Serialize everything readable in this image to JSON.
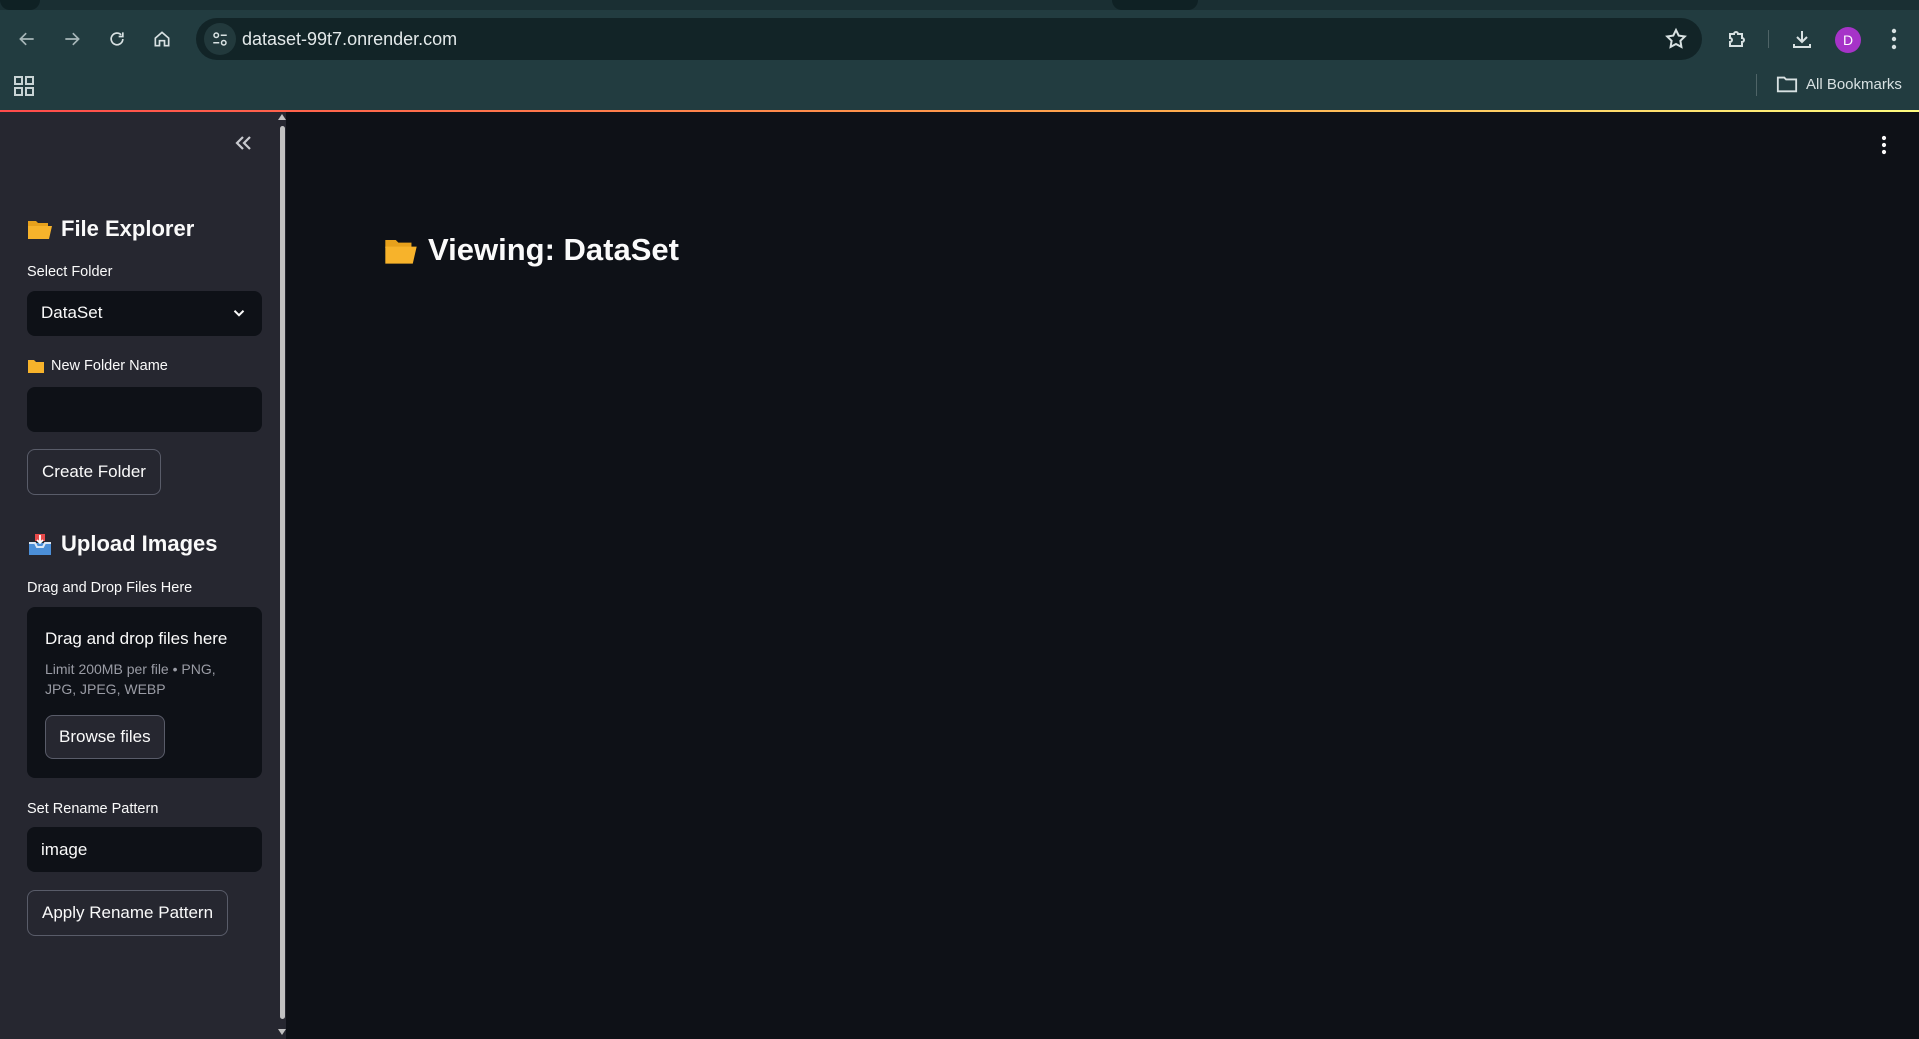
{
  "browser": {
    "url": "dataset-99t7.onrender.com",
    "avatar_initial": "D",
    "bookmarks_label": "All Bookmarks",
    "icons": [
      "back-icon",
      "forward-icon",
      "reload-icon",
      "home-icon",
      "site-info-icon",
      "star-icon",
      "extensions-icon",
      "download-icon",
      "menu-icon",
      "apps-icon",
      "folder-icon"
    ]
  },
  "sidebar": {
    "file_explorer_title": "File Explorer",
    "select_folder_label": "Select Folder",
    "selected_folder": "DataSet",
    "new_folder_label": "New Folder Name",
    "new_folder_value": "",
    "create_folder_button": "Create Folder",
    "upload_title": "Upload Images",
    "drag_drop_label": "Drag and Drop Files Here",
    "dropzone_title": "Drag and drop files here",
    "dropzone_limit": "Limit 200MB per file • PNG, JPG, JPEG, WEBP",
    "browse_button": "Browse files",
    "rename_label": "Set Rename Pattern",
    "rename_value": "image",
    "apply_rename_button": "Apply Rename Pattern"
  },
  "main": {
    "title": "Viewing: DataSet"
  },
  "colors": {
    "app_bg": "#0e1117",
    "sidebar_bg": "#262730",
    "browser_toolbar": "#223c40",
    "folder_yellow": "#f7b32b",
    "avatar": "#a633c8"
  }
}
